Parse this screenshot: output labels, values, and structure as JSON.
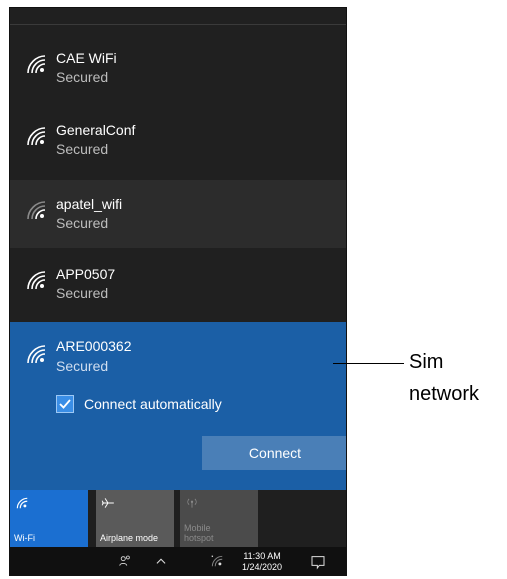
{
  "networks": [
    {
      "name": "CAE WiFi",
      "status": "Secured"
    },
    {
      "name": "GeneralConf",
      "status": "Secured"
    },
    {
      "name": "apatel_wifi",
      "status": "Secured"
    },
    {
      "name": "APP0507",
      "status": "Secured"
    }
  ],
  "selected_network": {
    "name": "ARE000362",
    "status": "Secured",
    "auto_connect_label": "Connect automatically",
    "auto_connect_checked": true,
    "connect_label": "Connect"
  },
  "quick_actions": {
    "wifi": {
      "label": "Wi-Fi",
      "icon": "wifi-icon",
      "active": true
    },
    "airplane": {
      "label": "Airplane mode",
      "icon": "airplane-icon",
      "active": false
    },
    "hotspot": {
      "label_line1": "Mobile",
      "label_line2": "hotspot",
      "icon": "hotspot-icon",
      "enabled": false
    }
  },
  "taskbar": {
    "time": "11:30 AM",
    "date": "1/24/2020",
    "icons": [
      "people-icon",
      "chevron-up-icon",
      "wifi-status-icon",
      "notification-icon"
    ]
  },
  "annotation": {
    "line1": "Sim",
    "line2": "network"
  },
  "colors": {
    "panel_bg": "#202020",
    "selected_bg": "#1b5fa6",
    "wifi_tile": "#1b6fd1",
    "connect_button": "#4a7fb7"
  }
}
